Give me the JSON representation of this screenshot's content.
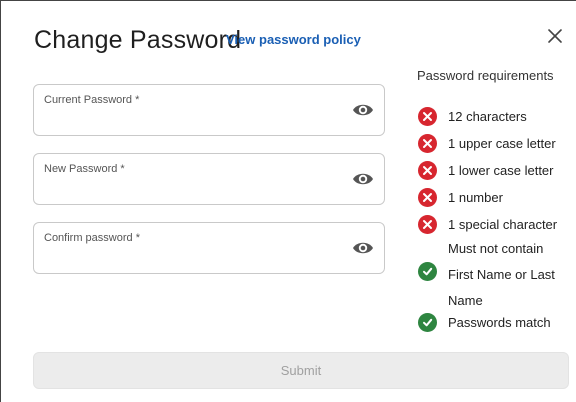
{
  "dialog": {
    "title": "Change Password",
    "policy_link": "View password policy",
    "close_icon": "close-icon"
  },
  "fields": [
    {
      "label": "Current Password *",
      "value": "",
      "icon": "eye-icon"
    },
    {
      "label": "New Password *",
      "value": "",
      "icon": "eye-icon"
    },
    {
      "label": "Confirm password *",
      "value": "",
      "icon": "eye-icon"
    }
  ],
  "requirements": {
    "title": "Password requirements",
    "items": [
      {
        "text": "12 characters",
        "status": "fail"
      },
      {
        "text": "1 upper case letter",
        "status": "fail"
      },
      {
        "text": "1 lower case letter",
        "status": "fail"
      },
      {
        "text": "1 number",
        "status": "fail"
      },
      {
        "text": "1 special character",
        "status": "fail"
      },
      {
        "text": "Must not contain First Name or Last Name",
        "status": "pass"
      },
      {
        "text": "Passwords match",
        "status": "pass"
      }
    ]
  },
  "submit": {
    "label": "Submit",
    "disabled": true
  },
  "colors": {
    "fail": "#d7262f",
    "pass": "#2e8540",
    "link": "#1a5fb4",
    "disabled_bg": "#ececec",
    "disabled_text": "#a0a0a0"
  }
}
